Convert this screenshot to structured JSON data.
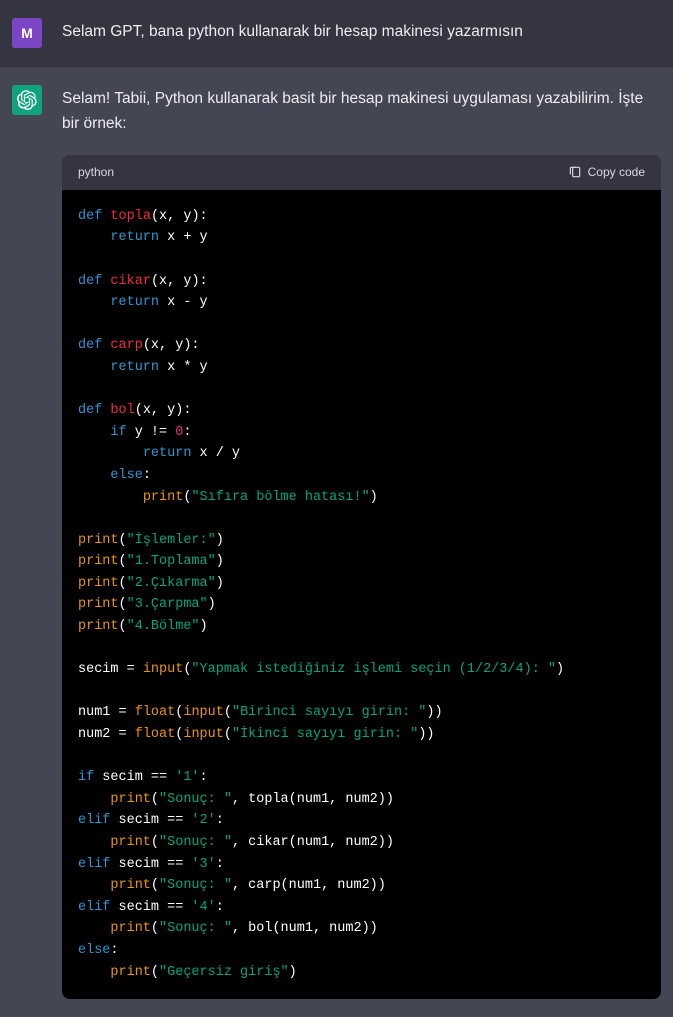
{
  "user": {
    "avatar_letter": "M",
    "message": "Selam GPT, bana python kullanarak bir hesap makinesi yazarmısın"
  },
  "assistant": {
    "intro": "Selam! Tabii, Python kullanarak basit bir hesap makinesi uygulaması yazabilirim. İşte bir örnek:"
  },
  "code": {
    "language_label": "python",
    "copy_label": "Copy code",
    "functions": {
      "topla": "topla",
      "cikar": "cikar",
      "carp": "carp",
      "bol": "bol"
    },
    "zero_msg": "\"Sıfıra bölme hatası!\"",
    "menu": {
      "header": "\"İşlemler:\"",
      "opt1": "\"1.Toplama\"",
      "opt2": "\"2.Çıkarma\"",
      "opt3": "\"3.Çarpma\"",
      "opt4": "\"4.Bölme\""
    },
    "prompt_select": "\"Yapmak istediğiniz işlemi seçin (1/2/3/4): \"",
    "prompt_num1": "\"Birinci sayıyı girin: \"",
    "prompt_num2": "\"İkinci sayıyı girin: \"",
    "result_label": "\"Sonuç: \"",
    "invalid_msg": "\"Geçersiz giriş\"",
    "sel1": "'1'",
    "sel2": "'2'",
    "sel3": "'3'",
    "sel4": "'4'",
    "kw": {
      "def": "def",
      "return": "return",
      "if": "if",
      "elif": "elif",
      "else": "else"
    },
    "builtins": {
      "print": "print",
      "input": "input",
      "float": "float"
    },
    "zero": "0"
  }
}
